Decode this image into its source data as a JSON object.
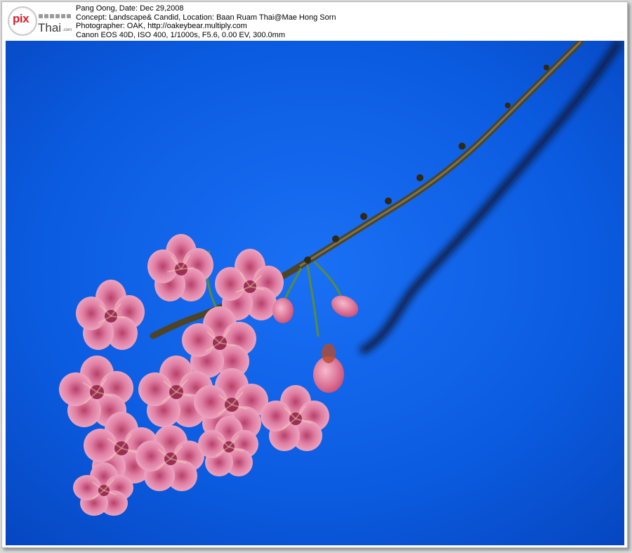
{
  "watermark": {
    "logo_pix": "pix",
    "logo_thai": "Thai",
    "logo_dotcom": ".com"
  },
  "caption": {
    "line1": "Pang Oong, Date: Dec 29,2008",
    "line2": "Concept: Landscape& Candid, Location: Baan Ruam Thai@Mae Hong Sorn",
    "line3": "Photographer: OAK, http://oakeybear.multiply.com",
    "line4": "Canon EOS 40D, ISO 400, 1/1000s, F5.6, 0.00 EV, 300.0mm"
  },
  "photo": {
    "subject": "pink cherry blossoms on a branch against blue sky",
    "colors": {
      "sky": "#0b5be0",
      "petal": "#e98fb0",
      "petal_dark": "#c9507a",
      "branch": "#5a5030",
      "shadow_branch": "#10224a",
      "stamen": "#f4e6a0"
    }
  }
}
